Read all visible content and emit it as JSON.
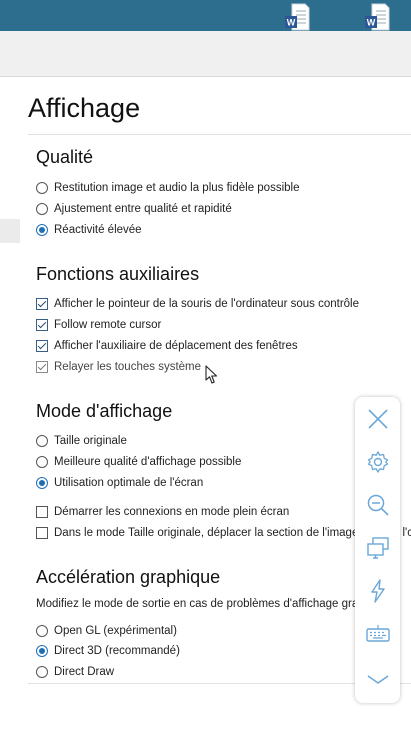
{
  "header": {
    "doc_icons": [
      "word-document-icon",
      "word-document-icon"
    ],
    "doc_icon_letter": "W"
  },
  "page": {
    "title": "Affichage"
  },
  "quality": {
    "title": "Qualité",
    "options": [
      {
        "label": "Restitution image et audio la plus fidèle possible",
        "selected": false
      },
      {
        "label": "Ajustement entre qualité et rapidité",
        "selected": false
      },
      {
        "label": "Réactivité élevée",
        "selected": true
      }
    ]
  },
  "aux": {
    "title": "Fonctions auxiliaires",
    "options": [
      {
        "label": "Afficher le pointeur de la souris de l'ordinateur sous contrôle",
        "checked": true
      },
      {
        "label": "Follow remote cursor",
        "checked": true
      },
      {
        "label": "Afficher l'auxiliaire de déplacement des fenêtres",
        "checked": true
      },
      {
        "label": "Relayer les touches système",
        "checked": true
      }
    ]
  },
  "display_mode": {
    "title": "Mode d'affichage",
    "options": [
      {
        "label": "Taille originale",
        "selected": false
      },
      {
        "label": "Meilleure qualité d'affichage possible",
        "selected": false
      },
      {
        "label": "Utilisation optimale de l'écran",
        "selected": true
      }
    ],
    "checks": [
      {
        "label": "Démarrer les connexions en mode plein écran",
        "checked": false
      },
      {
        "label": "Dans le mode Taille originale, déplacer la section de l'image lorsque l'c",
        "checked": false
      }
    ]
  },
  "graphics": {
    "title": "Accélération graphique",
    "description": "Modifiez le mode de sortie en cas de problèmes d'affichage graphique.",
    "options": [
      {
        "label": "Open GL (expérimental)",
        "selected": false
      },
      {
        "label": "Direct 3D (recommandé)",
        "selected": true
      },
      {
        "label": "Direct Draw",
        "selected": false
      }
    ]
  },
  "toolbar": {
    "buttons": [
      "close-icon",
      "gear-icon",
      "zoom-out-icon",
      "monitors-icon",
      "lightning-icon",
      "keyboard-icon",
      "chevron-down-icon"
    ]
  },
  "colors": {
    "topbar": "#2d6e8e",
    "accent": "#1f6fb8",
    "toolbar_icon": "#6aa7d8"
  }
}
